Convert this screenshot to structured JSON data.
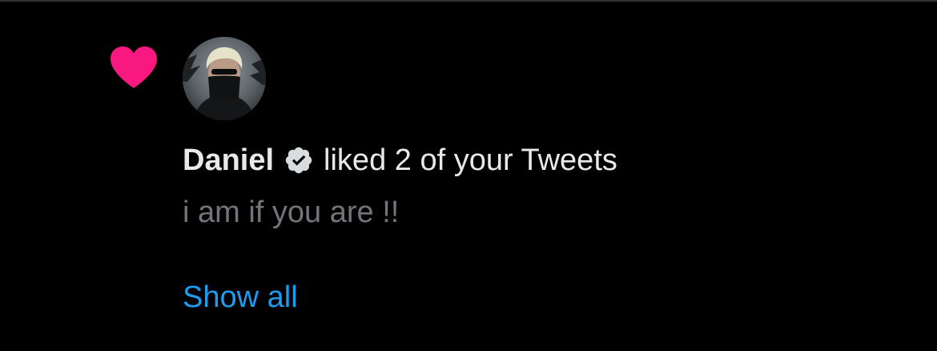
{
  "notification": {
    "icon": "heart-icon",
    "icon_color": "#f91880",
    "avatar": "user-avatar",
    "user_name": "Daniel",
    "verified_icon": "verified-badge-icon",
    "action": "liked 2 of your Tweets",
    "tweet_text": "i am if you are !!",
    "show_all_label": "Show all"
  },
  "colors": {
    "background": "#000000",
    "primary_text": "#e7e9ea",
    "secondary_text": "#71767b",
    "link": "#1d9bf0",
    "divider": "#2f3336"
  }
}
